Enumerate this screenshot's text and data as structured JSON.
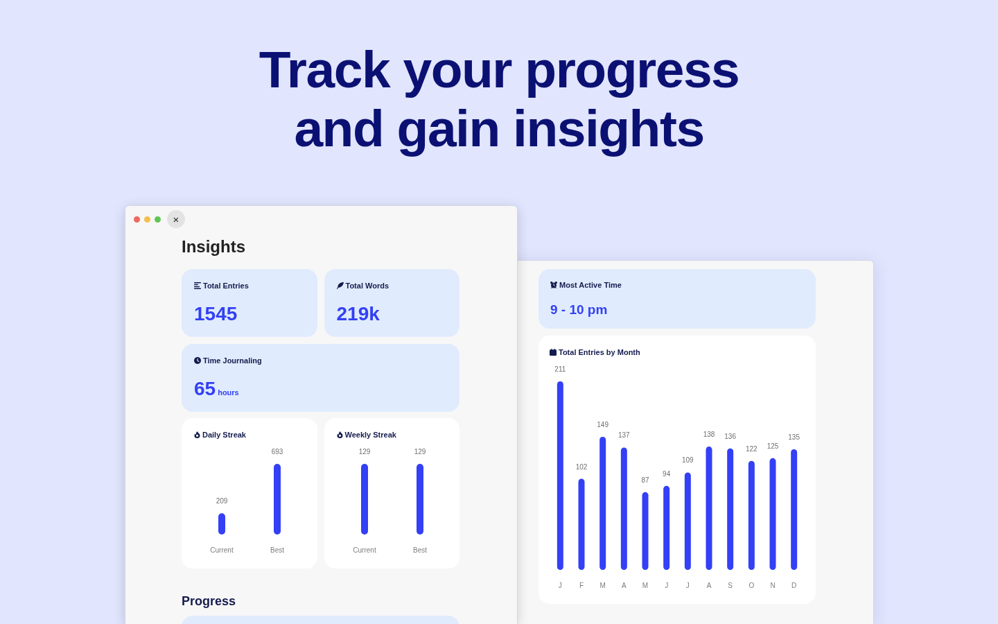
{
  "headline": {
    "lines": [
      "Track your progress",
      "and gain insights"
    ]
  },
  "insights_window": {
    "close_button": "×",
    "title": "Insights",
    "stat_cards": [
      {
        "label": "Total Entries",
        "value": "1545"
      },
      {
        "label": "Total Words",
        "value": "219k"
      }
    ],
    "time_journaling": {
      "label": "Time Journaling",
      "value": "65",
      "unit": "hours"
    },
    "streak_cards": [
      {
        "chart_data": {
          "type": "bar",
          "title": "Daily Streak",
          "categories": [
            "Current",
            "Best"
          ],
          "values": [
            209,
            693
          ],
          "data_labels": true
        }
      },
      {
        "chart_data": {
          "type": "bar",
          "title": "Weekly Streak",
          "categories": [
            "Current",
            "Best"
          ],
          "values": [
            129,
            129
          ],
          "data_labels": true
        }
      }
    ],
    "progress": {
      "title": "Progress"
    }
  },
  "activity_window": {
    "most_active_time": {
      "label": "Most Active Time",
      "value": "9 - 10 pm"
    },
    "monthly_entries": {
      "chart_data": {
        "type": "bar",
        "title": "Total Entries by Month",
        "categories": [
          "J",
          "F",
          "M",
          "A",
          "M",
          "J",
          "J",
          "A",
          "S",
          "O",
          "N",
          "D"
        ],
        "values": [
          211,
          102,
          149,
          137,
          87,
          94,
          109,
          138,
          136,
          122,
          125,
          135
        ],
        "data_labels": true
      }
    }
  }
}
